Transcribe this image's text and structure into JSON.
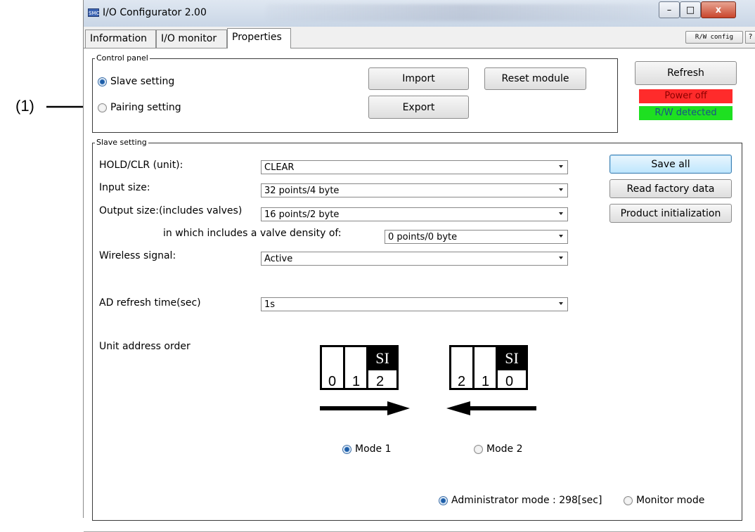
{
  "annotation": {
    "label": "(1)"
  },
  "window": {
    "title": "I/O Configurator 2.00",
    "app_icon_text": "SMC",
    "minimize_glyph": "–",
    "maximize_glyph": "□",
    "close_glyph": "x"
  },
  "tabs": [
    {
      "label": "Information"
    },
    {
      "label": "I/O monitor"
    },
    {
      "label": "Properties"
    }
  ],
  "toolbar": {
    "rw_config_label": "R/W config",
    "help_label": "?"
  },
  "control_panel": {
    "legend": "Control panel",
    "slave_setting_label": "Slave setting",
    "pairing_setting_label": "Pairing setting",
    "import_label": "Import",
    "export_label": "Export",
    "reset_module_label": "Reset module",
    "refresh_label": "Refresh",
    "power_status": "Power off",
    "rw_status": "R/W detected",
    "power_color": "#ff2b2b",
    "rw_color": "#1ee021"
  },
  "slave_setting": {
    "legend": "Slave setting",
    "hold_clr_label": "HOLD/CLR (unit):",
    "hold_clr_value": "CLEAR",
    "input_size_label": "Input size:",
    "input_size_value": "32 points/4 byte",
    "output_size_label": "Output size:(includes valves)",
    "output_size_value": "16 points/2 byte",
    "valve_density_label": "in which includes a valve density of:",
    "valve_density_value": "0 points/0 byte",
    "wireless_label": "Wireless signal:",
    "wireless_value": "Active",
    "ad_refresh_label": "AD refresh time(sec)",
    "ad_refresh_value": "1s",
    "unit_order_label": "Unit address order",
    "save_all_label": "Save all",
    "read_factory_label": "Read factory data",
    "product_init_label": "Product initialization",
    "mode1_label": "Mode 1",
    "mode2_label": "Mode 2",
    "mode1_digits": [
      "0",
      "1",
      "2"
    ],
    "mode2_digits": [
      "2",
      "1",
      "0"
    ],
    "si_label": "SI"
  },
  "statusbar": {
    "admin_mode_label": "Administrator mode : 298[sec]",
    "monitor_mode_label": "Monitor mode"
  }
}
